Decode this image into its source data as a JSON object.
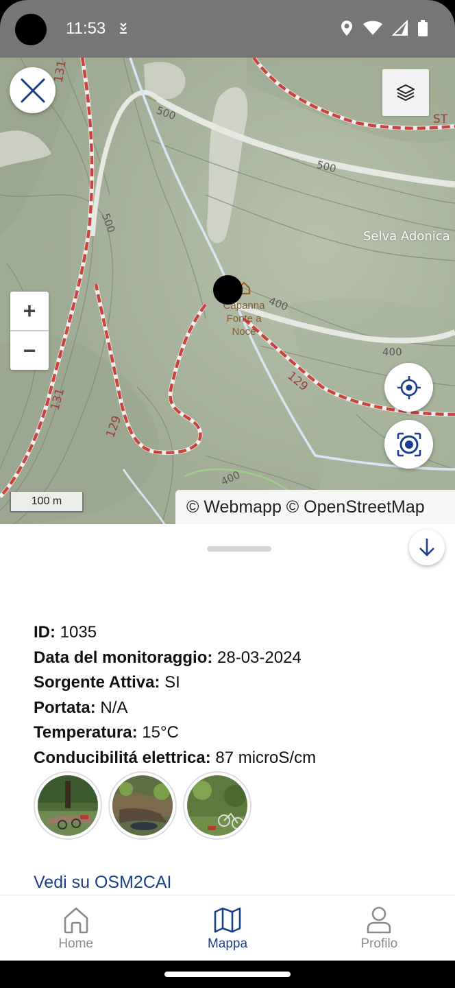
{
  "status_bar": {
    "time": "11:53",
    "icons": [
      "download-icon",
      "location-icon",
      "wifi-icon",
      "signal-icon",
      "battery-icon"
    ]
  },
  "map": {
    "labels": {
      "trail_131_a": "131",
      "trail_131_b": "131",
      "trail_129_a": "129",
      "trail_129_b": "129",
      "contour_500_a": "500",
      "contour_500_b": "500",
      "contour_500_c": "500",
      "contour_400_a": "400",
      "contour_400_b": "400",
      "contour_400_c": "400",
      "place": "Selva Adonica",
      "poi_line1": "Capanna",
      "poi_line2": "Fonte a",
      "poi_line3": "Noce",
      "st": "ST"
    },
    "zoom_in": "+",
    "zoom_out": "−",
    "scale": "100 m",
    "attribution": "© Webmapp © OpenStreetMap",
    "colors": {
      "background": "#a8b49a",
      "trail": "#c8453f",
      "river": "#cfe3ee"
    }
  },
  "details": {
    "fields": [
      {
        "label": "ID:",
        "value": " 1035"
      },
      {
        "label": "Data del monitoraggio:",
        "value": " 28-03-2024"
      },
      {
        "label": "Sorgente Attiva:",
        "value": " SI"
      },
      {
        "label": "Portata:",
        "value": " N/A"
      },
      {
        "label": "Temperatura:",
        "value": " 15°C"
      },
      {
        "label": "Conducibilitá elettrica:",
        "value": " 87 microS/cm"
      }
    ],
    "link": "Vedi su OSM2CAI"
  },
  "nav": {
    "items": [
      {
        "label": "Home",
        "icon": "home-icon",
        "active": false
      },
      {
        "label": "Mappa",
        "icon": "map-icon",
        "active": true
      },
      {
        "label": "Profilo",
        "icon": "profile-icon",
        "active": false
      }
    ],
    "colors": {
      "active": "#1c3f8c",
      "inactive": "#8a8a8a"
    }
  }
}
